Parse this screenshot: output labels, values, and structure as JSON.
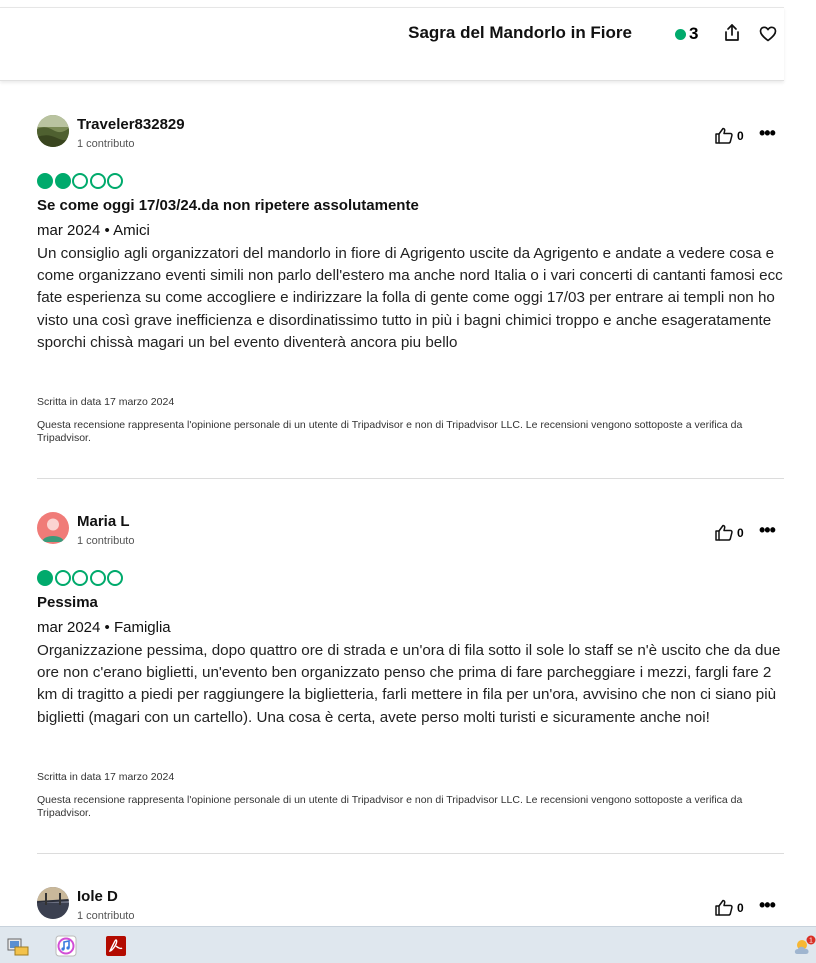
{
  "header": {
    "title": "Sagra del Mandorlo in Fiore",
    "review_count": "3",
    "icons": [
      "share-icon",
      "heart-icon"
    ],
    "accent_color": "#00aa6c"
  },
  "reviews": [
    {
      "user": "Traveler832829",
      "contributions": "1 contributo",
      "rating": 2,
      "likes": "0",
      "title": "Se come oggi 17/03/24.da non ripetere assolutamente",
      "meta": "mar 2024 • Amici",
      "body": "Un consiglio agli organizzatori del mandorlo in fiore di Agrigento uscite da Agrigento e andate a vedere cosa e come organizzano eventi simili non parlo dell'estero ma anche nord Italia o i vari concerti di cantanti famosi ecc fate esperienza su come accogliere e indirizzare la folla di gente come oggi 17/03 per entrare ai templi non ho visto una così grave inefficienza e disordinatissimo tutto in più i bagni chimici troppo e anche esageratamente sporchi chissà magari un bel evento diventerà ancora piu bello",
      "written": "Scritta in data 17 marzo 2024",
      "disclaimer": "Questa recensione rappresenta l'opinione personale di un utente di Tripadvisor e non di Tripadvisor LLC. Le recensioni vengono sottoposte a verifica da Tripadvisor."
    },
    {
      "user": "Maria L",
      "contributions": "1 contributo",
      "rating": 1,
      "likes": "0",
      "title": "Pessima",
      "meta": "mar 2024 • Famiglia",
      "body": "Organizzazione pessima, dopo quattro ore di strada e un'ora di fila sotto il sole lo staff se n'è uscito che da due ore non c'erano biglietti, un'evento ben organizzato penso che prima di fare parcheggiare i mezzi, fargli fare 2 km di tragitto a piedi per raggiungere la biglietteria, farli mettere in fila per un'ora, avvisino che non ci siano più biglietti (magari con un cartello). Una cosa è certa, avete perso molti turisti e sicuramente anche noi!",
      "written": "Scritta in data 17 marzo 2024",
      "disclaimer": "Questa recensione rappresenta l'opinione personale di un utente di Tripadvisor e non di Tripadvisor LLC. Le recensioni vengono sottoposte a verifica da Tripadvisor."
    },
    {
      "user": "Iole D",
      "contributions": "1 contributo",
      "likes": "0"
    }
  ],
  "taskbar": {
    "icons": [
      "file-explorer-icon",
      "itunes-icon",
      "acrobat-icon",
      "weather-icon"
    ],
    "notification_badge": "1"
  }
}
